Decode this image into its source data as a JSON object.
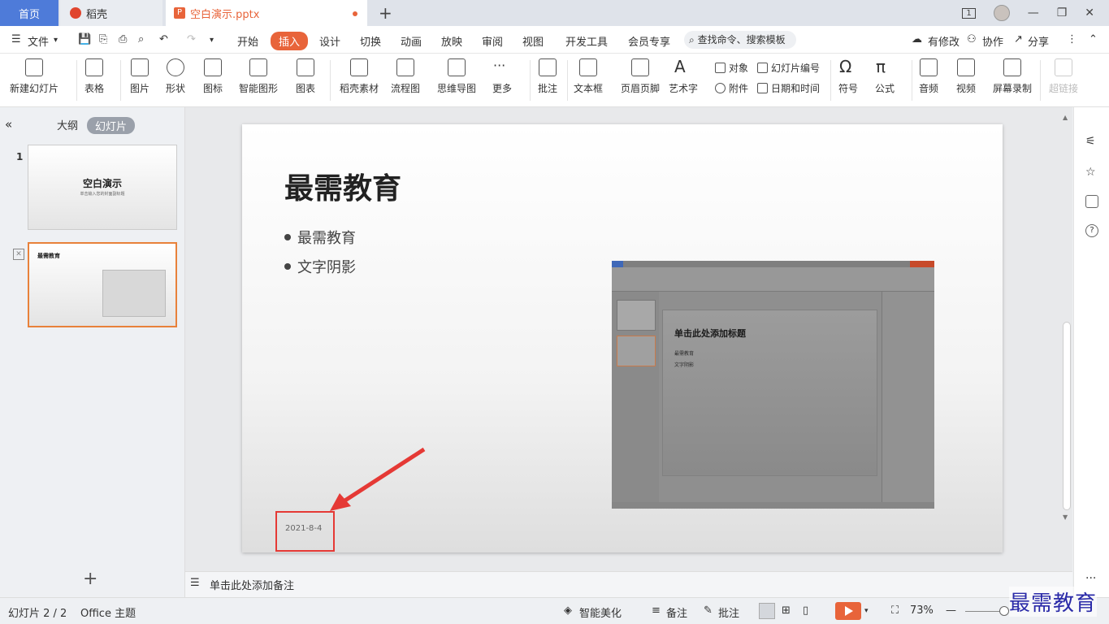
{
  "tabs": {
    "home": "首页",
    "daoke": "稻壳",
    "doc": "空白演示.pptx",
    "new_tab": "+"
  },
  "window": {
    "ctrl_count": "1",
    "min": "—",
    "max": "❐",
    "close": "✕"
  },
  "menu": {
    "file": "文件",
    "items": [
      "开始",
      "插入",
      "设计",
      "切换",
      "动画",
      "放映",
      "审阅",
      "视图",
      "开发工具",
      "会员专享"
    ],
    "active": "插入",
    "search": "查找命令、搜索模板",
    "right": [
      "有修改",
      "协作",
      "分享"
    ]
  },
  "ribbon": {
    "big": [
      "新建幻灯片",
      "表格",
      "图片",
      "形状",
      "图标",
      "智能图形",
      "图表",
      "稻壳素材",
      "流程图",
      "思维导图",
      "更多",
      "批注",
      "文本框",
      "页眉页脚",
      "艺术字",
      "符号",
      "公式",
      "音频",
      "视频",
      "屏幕录制",
      "超链接"
    ],
    "small": [
      "对象",
      "幻灯片编号",
      "附件",
      "日期和时间"
    ]
  },
  "left_pane": {
    "outline": "大纲",
    "slides": "幻灯片",
    "slide1_num": "1",
    "slide1_title": "空白演示",
    "slide1_sub": "单击输入您的封面副标题",
    "slide2_title": "最需教育",
    "add": "+"
  },
  "slide": {
    "title": "最需教育",
    "bullets": [
      "最需教育",
      "文字阴影"
    ],
    "date": "2021-8-4"
  },
  "embedded": {
    "title": "单击此处添加标题",
    "bullets": [
      "最需教育",
      "文字阴影"
    ]
  },
  "notes": {
    "placeholder": "单击此处添加备注"
  },
  "status": {
    "slide_info": "幻灯片 2 / 2",
    "theme": "Office 主题",
    "beautify": "智能美化",
    "notes": "备注",
    "comment": "批注",
    "zoom": "73%"
  },
  "watermark": "最需教育"
}
